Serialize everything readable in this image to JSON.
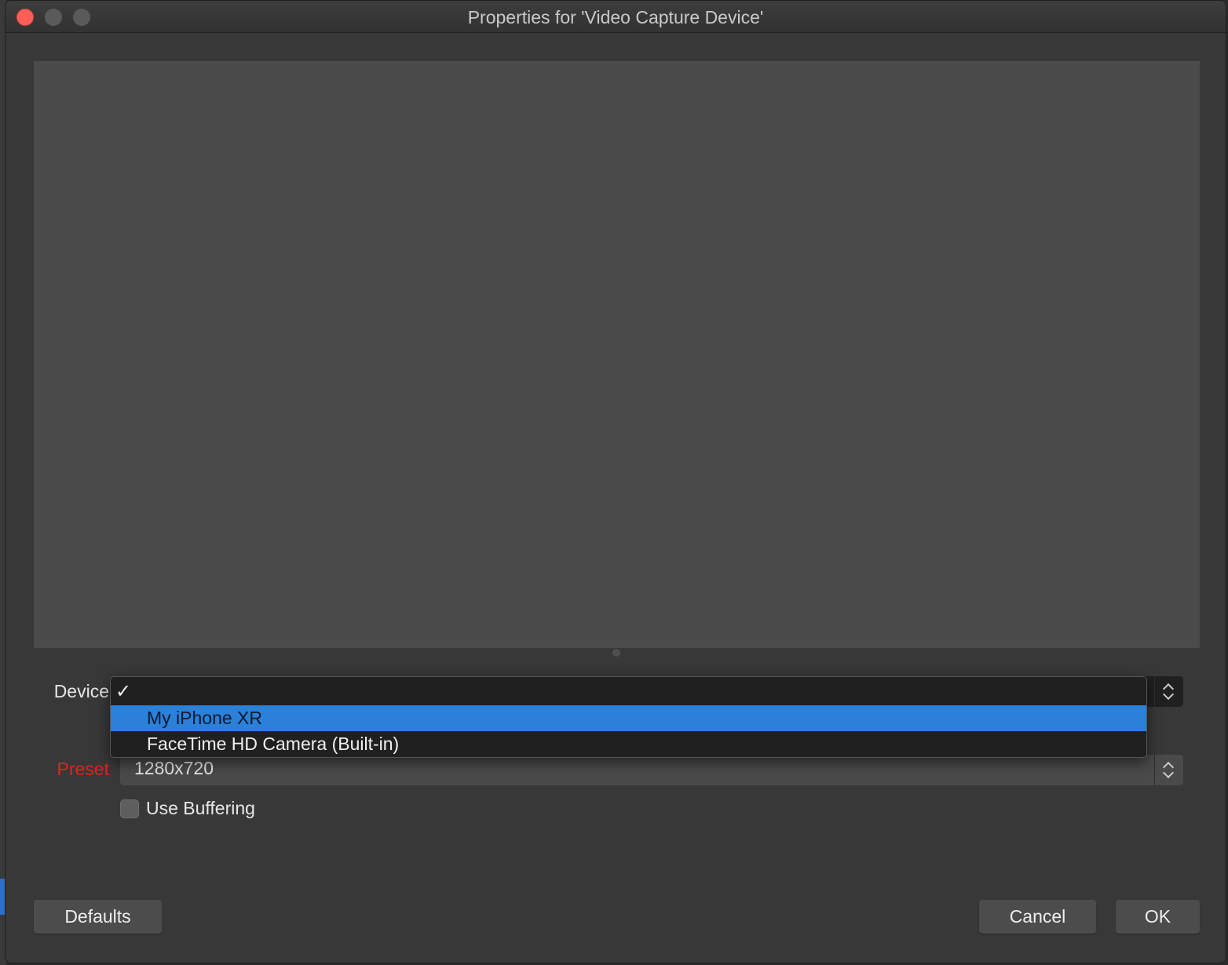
{
  "window": {
    "title": "Properties for 'Video Capture Device'"
  },
  "form": {
    "device_label": "Device",
    "device_value": "",
    "preset_label": "Preset",
    "preset_value": "1280x720",
    "buffering_label": "Use Buffering",
    "buffering_checked": false
  },
  "device_dropdown": {
    "current_check": "✓",
    "options": [
      {
        "label": "My iPhone XR",
        "highlighted": true
      },
      {
        "label": "FaceTime HD Camera (Built-in)",
        "highlighted": false
      }
    ]
  },
  "buttons": {
    "defaults": "Defaults",
    "cancel": "Cancel",
    "ok": "OK"
  },
  "colors": {
    "highlight": "#2b80d8",
    "preset_label_error": "#e0241c",
    "close_button": "#ff5f57"
  }
}
